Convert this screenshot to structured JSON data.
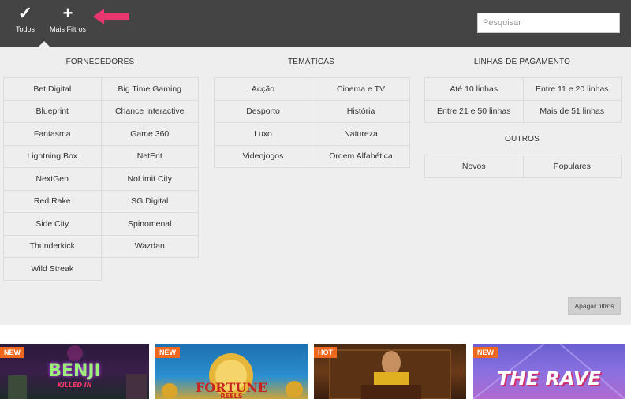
{
  "toolbar": {
    "todos_label": "Todos",
    "todos_icon": "check-icon",
    "mais_filtros_label": "Mais Filtros",
    "mais_filtros_icon": "plus-icon",
    "search_placeholder": "Pesquisar",
    "search_value": ""
  },
  "filters": {
    "fornecedores": {
      "title": "FORNECEDORES",
      "items": [
        "Bet Digital",
        "Big Time Gaming",
        "Blueprint",
        "Chance Interactive",
        "Fantasma",
        "Game 360",
        "Lightning Box",
        "NetEnt",
        "NextGen",
        "NoLimit City",
        "Red Rake",
        "SG Digital",
        "Side City",
        "Spinomenal",
        "Thunderkick",
        "Wazdan",
        "Wild Streak"
      ]
    },
    "tematicas": {
      "title": "TEMÁTICAS",
      "items": [
        "Acção",
        "Cinema e TV",
        "Desporto",
        "História",
        "Luxo",
        "Natureza",
        "Videojogos",
        "Ordem Alfabética"
      ]
    },
    "linhas": {
      "title": "LINHAS DE PAGAMENTO",
      "items": [
        "Até 10 linhas",
        "Entre 11 e 20 linhas",
        "Entre 21 e 50 linhas",
        "Mais de 51 linhas"
      ]
    },
    "outros": {
      "title": "OUTROS",
      "items": [
        "Novos",
        "Populares"
      ]
    },
    "clear_label": "Apagar filtros"
  },
  "games": [
    {
      "badge": "NEW",
      "title": "BENJI",
      "subtitle": "KILLED IN"
    },
    {
      "badge": "NEW",
      "title": "FORTUNE",
      "subtitle": "REELS"
    },
    {
      "badge": "HOT",
      "title": "",
      "subtitle": ""
    },
    {
      "badge": "NEW",
      "title": "THE RAVE",
      "subtitle": ""
    }
  ],
  "colors": {
    "topbar": "#444444",
    "panel": "#eeeeee",
    "badge": "#f0681e",
    "arrow": "#e8366f"
  }
}
